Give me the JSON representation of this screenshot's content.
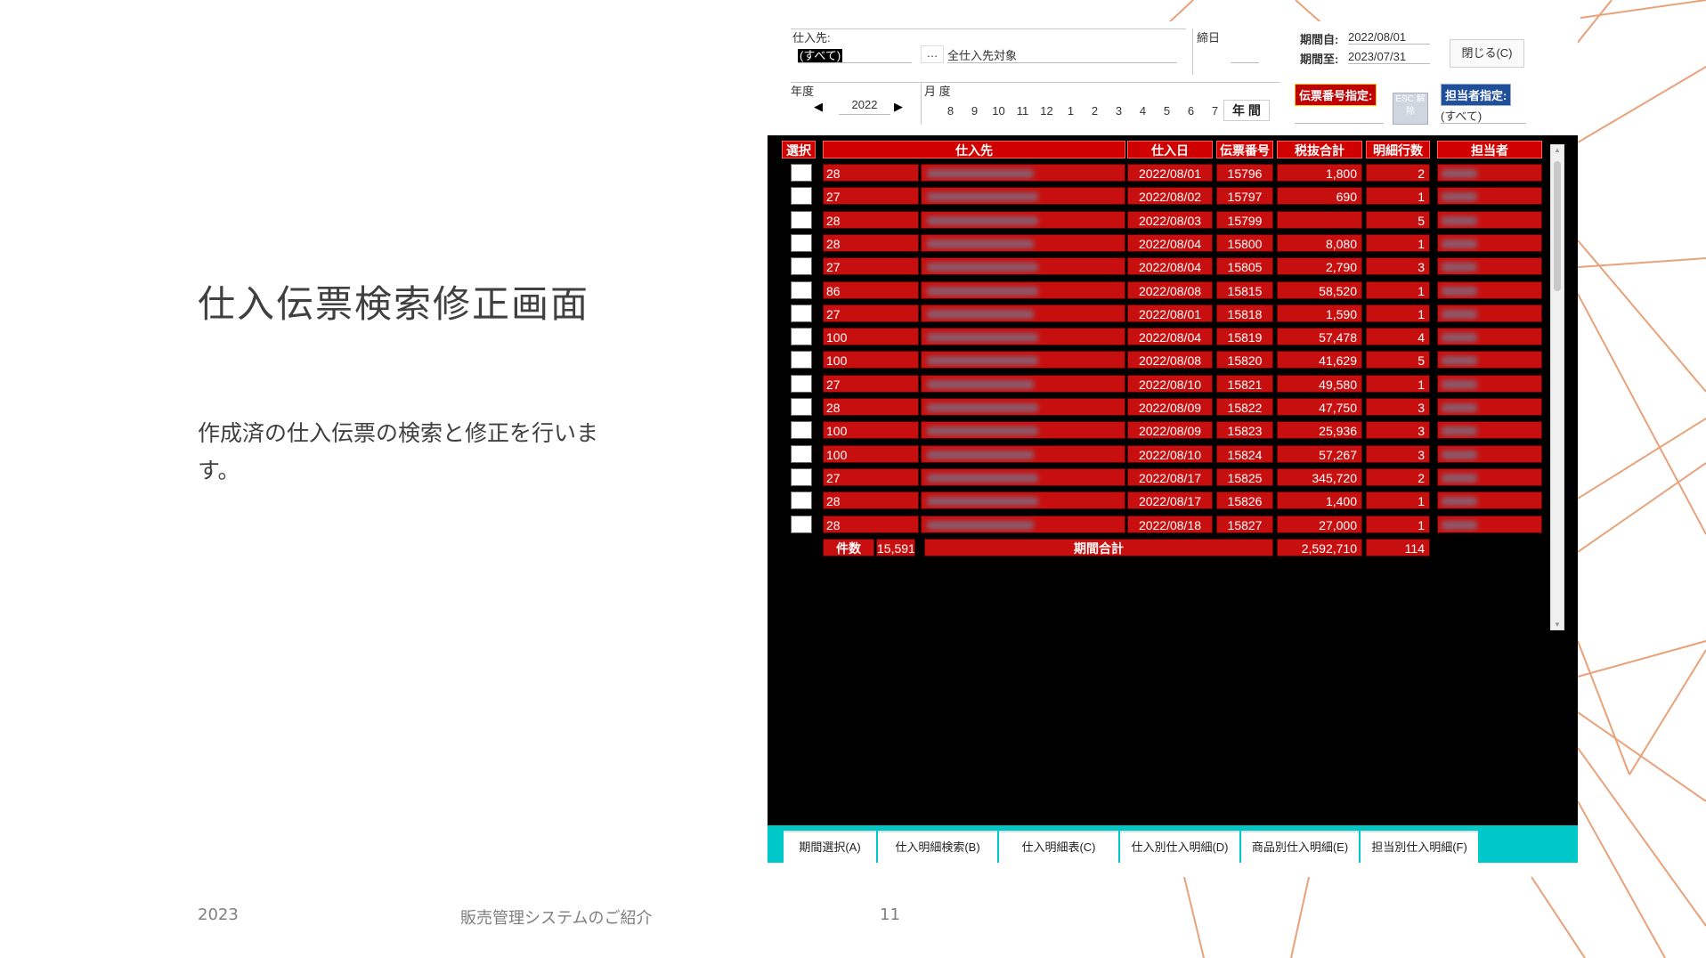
{
  "slide": {
    "title": "仕入伝票検索修正画面",
    "description": "作成済の仕入伝票の検索と修正を行います。",
    "footer_year": "2023",
    "footer_center": "販売管理システムのご紹介",
    "page_number": "11"
  },
  "colors": {
    "line_accent": "#e8a27a",
    "row_red": "#c80f0f",
    "tab_bar": "#00c8c8"
  },
  "header": {
    "supplier_label": "仕入先:",
    "supplier_value": "(すべて)",
    "supplier_picker_button": "…",
    "supplier_desc": "全仕入先対象",
    "closing_day_label": "締日",
    "period_from_label": "期間自:",
    "period_from_value": "2022/08/01",
    "period_to_label": "期間至:",
    "period_to_value": "2023/07/31",
    "close_button": "閉じる(C)",
    "year_label": "年度",
    "year_value": "2022",
    "month_label": "月 度",
    "months": [
      "8",
      "9",
      "10",
      "11",
      "12",
      "1",
      "2",
      "3",
      "4",
      "5",
      "6",
      "7"
    ],
    "annual_button": "年 間",
    "slip_number_tag": "伝票番号指定:",
    "esc_button": "ESC 解除",
    "staff_tag": "担当者指定:",
    "staff_value": "(すべて)"
  },
  "table": {
    "columns": [
      "選択",
      "仕入先",
      "仕入日",
      "伝票番号",
      "税抜合計",
      "明細行数",
      "担当者"
    ],
    "rows": [
      {
        "code": "28",
        "date": "2022/08/01",
        "slip": "15796",
        "total": "1,800",
        "lines": "2"
      },
      {
        "code": "27",
        "date": "2022/08/02",
        "slip": "15797",
        "total": "690",
        "lines": "1"
      },
      {
        "code": "28",
        "date": "2022/08/03",
        "slip": "15799",
        "total": "",
        "lines": "5"
      },
      {
        "code": "28",
        "date": "2022/08/04",
        "slip": "15800",
        "total": "8,080",
        "lines": "1"
      },
      {
        "code": "27",
        "date": "2022/08/04",
        "slip": "15805",
        "total": "2,790",
        "lines": "3"
      },
      {
        "code": "86",
        "date": "2022/08/08",
        "slip": "15815",
        "total": "58,520",
        "lines": "1"
      },
      {
        "code": "27",
        "date": "2022/08/01",
        "slip": "15818",
        "total": "1,590",
        "lines": "1"
      },
      {
        "code": "100",
        "date": "2022/08/04",
        "slip": "15819",
        "total": "57,478",
        "lines": "4"
      },
      {
        "code": "100",
        "date": "2022/08/08",
        "slip": "15820",
        "total": "41,629",
        "lines": "5"
      },
      {
        "code": "27",
        "date": "2022/08/10",
        "slip": "15821",
        "total": "49,580",
        "lines": "1"
      },
      {
        "code": "28",
        "date": "2022/08/09",
        "slip": "15822",
        "total": "47,750",
        "lines": "3"
      },
      {
        "code": "100",
        "date": "2022/08/09",
        "slip": "15823",
        "total": "25,936",
        "lines": "3"
      },
      {
        "code": "100",
        "date": "2022/08/10",
        "slip": "15824",
        "total": "57,267",
        "lines": "3"
      },
      {
        "code": "27",
        "date": "2022/08/17",
        "slip": "15825",
        "total": "345,720",
        "lines": "2"
      },
      {
        "code": "28",
        "date": "2022/08/17",
        "slip": "15826",
        "total": "1,400",
        "lines": "1"
      },
      {
        "code": "28",
        "date": "2022/08/18",
        "slip": "15827",
        "total": "27,000",
        "lines": "1"
      }
    ],
    "footer": {
      "count_label": "件数",
      "count_value": "15,591",
      "period_total_label": "期間合計",
      "total_value": "2,592,710",
      "lines_value": "114"
    }
  },
  "tabs": [
    "期間選択(A)",
    "仕入明細検索(B)",
    "仕入明細表(C)",
    "仕入別仕入明細(D)",
    "商品別仕入明細(E)",
    "担当別仕入明細(F)"
  ]
}
